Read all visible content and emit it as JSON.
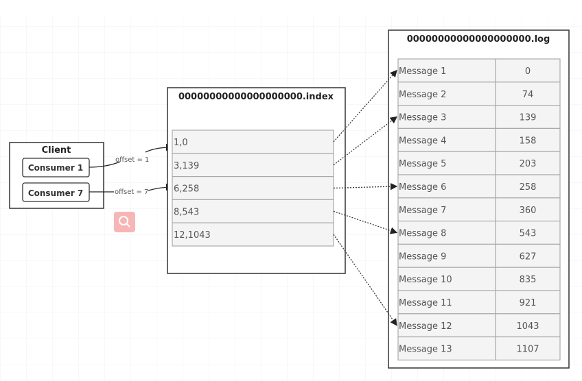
{
  "client": {
    "title": "Client",
    "consumers": [
      {
        "label": "Consumer 1",
        "offset_label": "offset = 1"
      },
      {
        "label": "Consumer 7",
        "offset_label": "offset = 7"
      }
    ]
  },
  "index_file": {
    "title": "00000000000000000000.index",
    "entries": [
      "1,0",
      "3,139",
      "6,258",
      "8,543",
      "12,1043"
    ]
  },
  "log_file": {
    "title": "00000000000000000000.log",
    "rows": [
      [
        "Message 1",
        "0"
      ],
      [
        "Message 2",
        "74"
      ],
      [
        "Message 3",
        "139"
      ],
      [
        "Message 4",
        "158"
      ],
      [
        "Message 5",
        "203"
      ],
      [
        "Message 6",
        "258"
      ],
      [
        "Message 7",
        "360"
      ],
      [
        "Message 8",
        "543"
      ],
      [
        "Message 9",
        "627"
      ],
      [
        "Message 10",
        "835"
      ],
      [
        "Message 11",
        "921"
      ],
      [
        "Message 12",
        "1043"
      ],
      [
        "Message 13",
        "1107"
      ]
    ]
  },
  "links": [
    {
      "from_index_entry": "1,0",
      "to_message": "Message 1"
    },
    {
      "from_index_entry": "3,139",
      "to_message": "Message 3"
    },
    {
      "from_index_entry": "6,258",
      "to_message": "Message 6"
    },
    {
      "from_index_entry": "8,543",
      "to_message": "Message 8"
    },
    {
      "from_index_entry": "12,1043",
      "to_message": "Message 12"
    }
  ],
  "icons": {
    "search": "magnifier-icon"
  },
  "colors": {
    "search_icon_bg": "#f7b6b6",
    "cell_fill": "#f4f4f4",
    "border": "#333333"
  }
}
